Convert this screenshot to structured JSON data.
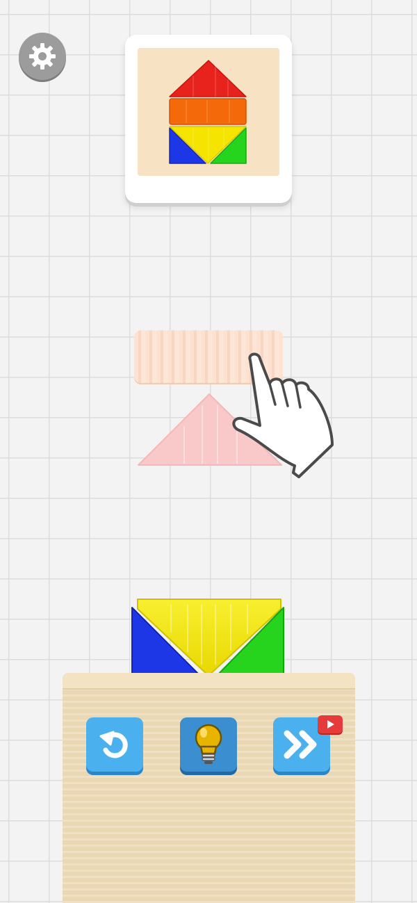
{
  "settings": {
    "icon": "gear-icon",
    "color": "#9c9c9c"
  },
  "target_preview": {
    "board_color": "#f7e3c3",
    "pieces": [
      {
        "shape": "triangle",
        "color": "#e8231d"
      },
      {
        "shape": "rectangle",
        "color": "#f46a0a"
      },
      {
        "shape": "triangle",
        "color": "#1d36e6"
      },
      {
        "shape": "triangle",
        "color": "#f4e400"
      },
      {
        "shape": "triangle",
        "color": "#26d41e"
      }
    ]
  },
  "hint_ghost": {
    "pieces": [
      {
        "shape": "rectangle",
        "color": "#fde2d2"
      },
      {
        "shape": "triangle",
        "color": "#f9c8c8"
      }
    ],
    "cursor_icon": "hand-pointer-icon"
  },
  "placed_pieces": [
    {
      "shape": "triangle",
      "color": "#1d36e6"
    },
    {
      "shape": "triangle",
      "color": "#f4e400"
    },
    {
      "shape": "triangle",
      "color": "#26d41e"
    }
  ],
  "toolbar": {
    "undo": {
      "icon": "undo-icon",
      "color": "#4bb1ee"
    },
    "hint": {
      "icon": "lightbulb-icon",
      "color": "#3b8fd0"
    },
    "skip": {
      "icon": "fast-forward-icon",
      "color": "#4bb1ee",
      "badge_icon": "video-play-icon"
    }
  }
}
